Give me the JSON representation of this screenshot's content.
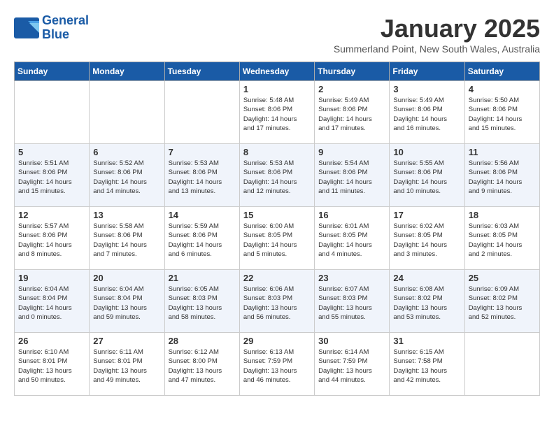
{
  "header": {
    "logo_line1": "General",
    "logo_line2": "Blue",
    "month": "January 2025",
    "location": "Summerland Point, New South Wales, Australia"
  },
  "weekdays": [
    "Sunday",
    "Monday",
    "Tuesday",
    "Wednesday",
    "Thursday",
    "Friday",
    "Saturday"
  ],
  "weeks": [
    [
      {
        "day": "",
        "info": ""
      },
      {
        "day": "",
        "info": ""
      },
      {
        "day": "",
        "info": ""
      },
      {
        "day": "1",
        "info": "Sunrise: 5:48 AM\nSunset: 8:06 PM\nDaylight: 14 hours\nand 17 minutes."
      },
      {
        "day": "2",
        "info": "Sunrise: 5:49 AM\nSunset: 8:06 PM\nDaylight: 14 hours\nand 17 minutes."
      },
      {
        "day": "3",
        "info": "Sunrise: 5:49 AM\nSunset: 8:06 PM\nDaylight: 14 hours\nand 16 minutes."
      },
      {
        "day": "4",
        "info": "Sunrise: 5:50 AM\nSunset: 8:06 PM\nDaylight: 14 hours\nand 15 minutes."
      }
    ],
    [
      {
        "day": "5",
        "info": "Sunrise: 5:51 AM\nSunset: 8:06 PM\nDaylight: 14 hours\nand 15 minutes."
      },
      {
        "day": "6",
        "info": "Sunrise: 5:52 AM\nSunset: 8:06 PM\nDaylight: 14 hours\nand 14 minutes."
      },
      {
        "day": "7",
        "info": "Sunrise: 5:53 AM\nSunset: 8:06 PM\nDaylight: 14 hours\nand 13 minutes."
      },
      {
        "day": "8",
        "info": "Sunrise: 5:53 AM\nSunset: 8:06 PM\nDaylight: 14 hours\nand 12 minutes."
      },
      {
        "day": "9",
        "info": "Sunrise: 5:54 AM\nSunset: 8:06 PM\nDaylight: 14 hours\nand 11 minutes."
      },
      {
        "day": "10",
        "info": "Sunrise: 5:55 AM\nSunset: 8:06 PM\nDaylight: 14 hours\nand 10 minutes."
      },
      {
        "day": "11",
        "info": "Sunrise: 5:56 AM\nSunset: 8:06 PM\nDaylight: 14 hours\nand 9 minutes."
      }
    ],
    [
      {
        "day": "12",
        "info": "Sunrise: 5:57 AM\nSunset: 8:06 PM\nDaylight: 14 hours\nand 8 minutes."
      },
      {
        "day": "13",
        "info": "Sunrise: 5:58 AM\nSunset: 8:06 PM\nDaylight: 14 hours\nand 7 minutes."
      },
      {
        "day": "14",
        "info": "Sunrise: 5:59 AM\nSunset: 8:06 PM\nDaylight: 14 hours\nand 6 minutes."
      },
      {
        "day": "15",
        "info": "Sunrise: 6:00 AM\nSunset: 8:05 PM\nDaylight: 14 hours\nand 5 minutes."
      },
      {
        "day": "16",
        "info": "Sunrise: 6:01 AM\nSunset: 8:05 PM\nDaylight: 14 hours\nand 4 minutes."
      },
      {
        "day": "17",
        "info": "Sunrise: 6:02 AM\nSunset: 8:05 PM\nDaylight: 14 hours\nand 3 minutes."
      },
      {
        "day": "18",
        "info": "Sunrise: 6:03 AM\nSunset: 8:05 PM\nDaylight: 14 hours\nand 2 minutes."
      }
    ],
    [
      {
        "day": "19",
        "info": "Sunrise: 6:04 AM\nSunset: 8:04 PM\nDaylight: 14 hours\nand 0 minutes."
      },
      {
        "day": "20",
        "info": "Sunrise: 6:04 AM\nSunset: 8:04 PM\nDaylight: 13 hours\nand 59 minutes."
      },
      {
        "day": "21",
        "info": "Sunrise: 6:05 AM\nSunset: 8:03 PM\nDaylight: 13 hours\nand 58 minutes."
      },
      {
        "day": "22",
        "info": "Sunrise: 6:06 AM\nSunset: 8:03 PM\nDaylight: 13 hours\nand 56 minutes."
      },
      {
        "day": "23",
        "info": "Sunrise: 6:07 AM\nSunset: 8:03 PM\nDaylight: 13 hours\nand 55 minutes."
      },
      {
        "day": "24",
        "info": "Sunrise: 6:08 AM\nSunset: 8:02 PM\nDaylight: 13 hours\nand 53 minutes."
      },
      {
        "day": "25",
        "info": "Sunrise: 6:09 AM\nSunset: 8:02 PM\nDaylight: 13 hours\nand 52 minutes."
      }
    ],
    [
      {
        "day": "26",
        "info": "Sunrise: 6:10 AM\nSunset: 8:01 PM\nDaylight: 13 hours\nand 50 minutes."
      },
      {
        "day": "27",
        "info": "Sunrise: 6:11 AM\nSunset: 8:01 PM\nDaylight: 13 hours\nand 49 minutes."
      },
      {
        "day": "28",
        "info": "Sunrise: 6:12 AM\nSunset: 8:00 PM\nDaylight: 13 hours\nand 47 minutes."
      },
      {
        "day": "29",
        "info": "Sunrise: 6:13 AM\nSunset: 7:59 PM\nDaylight: 13 hours\nand 46 minutes."
      },
      {
        "day": "30",
        "info": "Sunrise: 6:14 AM\nSunset: 7:59 PM\nDaylight: 13 hours\nand 44 minutes."
      },
      {
        "day": "31",
        "info": "Sunrise: 6:15 AM\nSunset: 7:58 PM\nDaylight: 13 hours\nand 42 minutes."
      },
      {
        "day": "",
        "info": ""
      }
    ]
  ]
}
